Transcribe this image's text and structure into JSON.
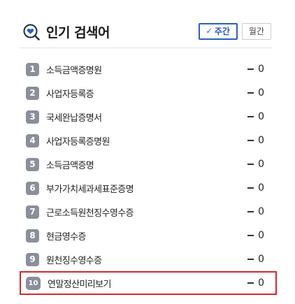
{
  "header": {
    "title": "인기 검색어",
    "icon": "search-heart-icon",
    "tabs": [
      {
        "label": "주간",
        "active": true
      },
      {
        "label": "월간",
        "active": false
      }
    ]
  },
  "colors": {
    "accent": "#2a5fc4",
    "rank_badge": "#8a8f99",
    "highlight_border": "#d9262b"
  },
  "items": [
    {
      "rank": "1",
      "term": "소득금액증명원",
      "change": "0"
    },
    {
      "rank": "2",
      "term": "사업자등록증",
      "change": "0"
    },
    {
      "rank": "3",
      "term": "국세완납증명서",
      "change": "0"
    },
    {
      "rank": "4",
      "term": "사업자등록증명원",
      "change": "0"
    },
    {
      "rank": "5",
      "term": "소득금액증명",
      "change": "0"
    },
    {
      "rank": "6",
      "term": "부가가치세과세표준증명",
      "change": "0"
    },
    {
      "rank": "7",
      "term": "근로소득원천징수영수증",
      "change": "0"
    },
    {
      "rank": "8",
      "term": "현금영수증",
      "change": "0"
    },
    {
      "rank": "9",
      "term": "원천징수영수증",
      "change": "0"
    },
    {
      "rank": "10",
      "term": "연말정산미리보기",
      "change": "0"
    }
  ]
}
